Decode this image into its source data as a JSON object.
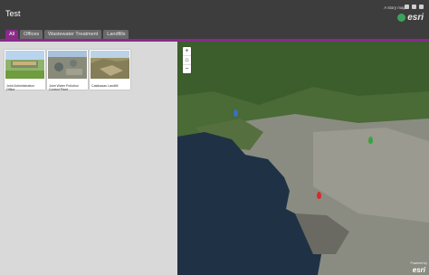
{
  "header": {
    "title": "Test",
    "storymap_label": "A story map",
    "esri_label": "esri"
  },
  "tabs": [
    {
      "label": "All",
      "active": true
    },
    {
      "label": "Offices",
      "active": false
    },
    {
      "label": "Wastewater Treatment",
      "active": false
    },
    {
      "label": "Landfills",
      "active": false
    }
  ],
  "cards": [
    {
      "caption": "Joint Administration Office"
    },
    {
      "caption": "Joint Water Pollution Control Plant"
    },
    {
      "caption": "Calabasas Landfill"
    }
  ],
  "map": {
    "zoom_in": "+",
    "home": "⌂",
    "zoom_out": "−",
    "esri_label": "esri",
    "attribution": "Powered by"
  },
  "colors": {
    "accent": "#8a2a8a",
    "header": "#3d3d3d",
    "pin_blue": "#3a6fc4",
    "pin_green": "#3aa33a",
    "pin_red": "#d62b2b"
  }
}
